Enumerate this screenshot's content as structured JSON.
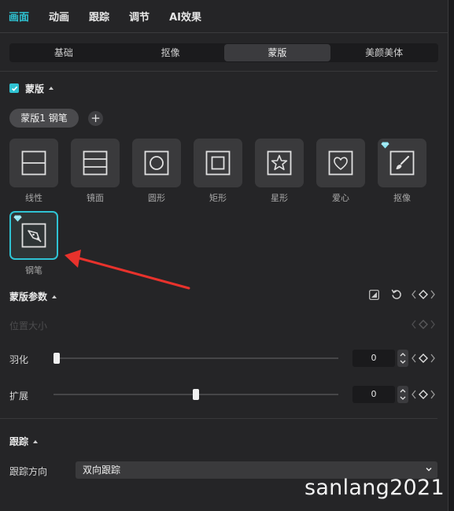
{
  "top_tabs": [
    "画面",
    "动画",
    "跟踪",
    "调节",
    "AI效果"
  ],
  "active_top_tab": "画面",
  "segments": [
    "基础",
    "抠像",
    "蒙版",
    "美颜美体"
  ],
  "active_segment": "蒙版",
  "mask_section": {
    "title": "蒙版",
    "checked": true,
    "chip_label": "蒙版1 钢笔",
    "add_label": "+"
  },
  "shapes": [
    {
      "label": "线性",
      "icon": "linear-mask-icon"
    },
    {
      "label": "镜面",
      "icon": "mirror-mask-icon"
    },
    {
      "label": "圆形",
      "icon": "circle-mask-icon"
    },
    {
      "label": "矩形",
      "icon": "rectangle-mask-icon"
    },
    {
      "label": "星形",
      "icon": "star-mask-icon"
    },
    {
      "label": "爱心",
      "icon": "heart-mask-icon"
    },
    {
      "label": "抠像",
      "icon": "brush-mask-icon",
      "premium": true
    },
    {
      "label": "钢笔",
      "icon": "pen-mask-icon",
      "premium": true,
      "selected": true
    }
  ],
  "params": {
    "title": "蒙版参数",
    "disabled_row_label": "位置大小",
    "feather": {
      "label": "羽化",
      "value": "0",
      "level": 0.0
    },
    "expand": {
      "label": "扩展",
      "value": "0",
      "level": 0.5
    }
  },
  "tracking": {
    "title": "跟踪",
    "direction_label": "跟踪方向",
    "direction_value": "双向跟踪"
  },
  "watermark": "sanlang2021",
  "colors": {
    "accent": "#2fc3d3",
    "panel": "#252527",
    "annotation_arrow": "#e8322c"
  }
}
